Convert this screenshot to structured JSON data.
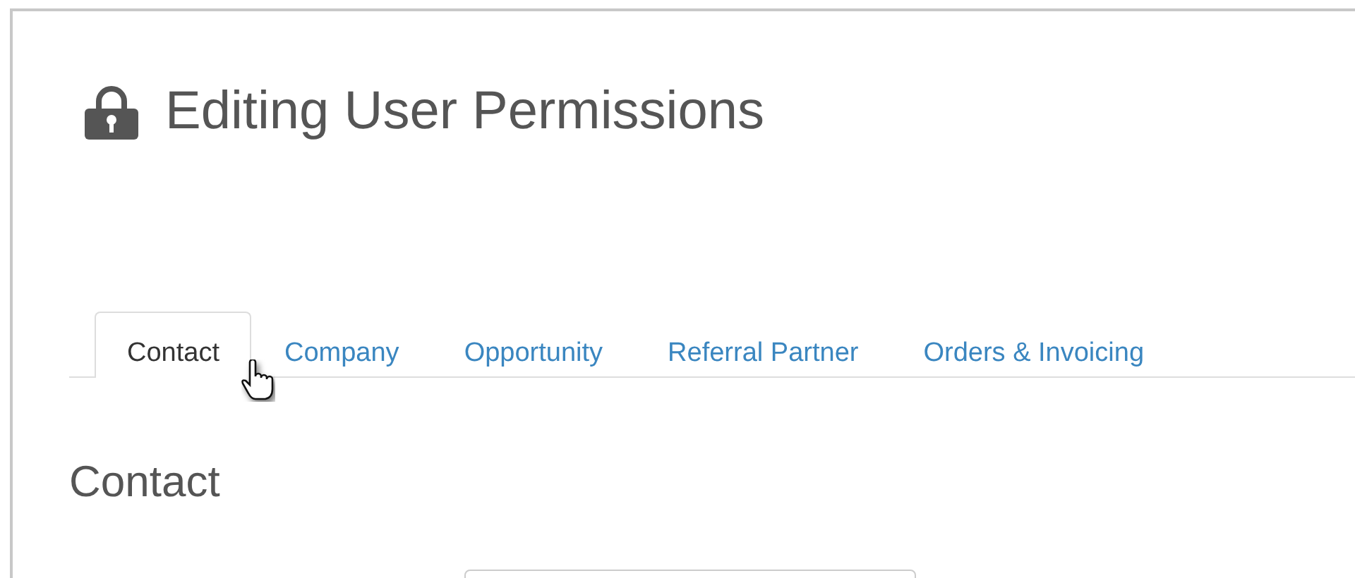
{
  "page": {
    "title": "Editing User Permissions"
  },
  "tabs": [
    {
      "label": "Contact",
      "selected": true
    },
    {
      "label": "Company",
      "selected": false
    },
    {
      "label": "Opportunity",
      "selected": false
    },
    {
      "label": "Referral Partner",
      "selected": false
    },
    {
      "label": "Orders & Invoicing",
      "selected": false
    }
  ],
  "section": {
    "heading": "Contact"
  }
}
